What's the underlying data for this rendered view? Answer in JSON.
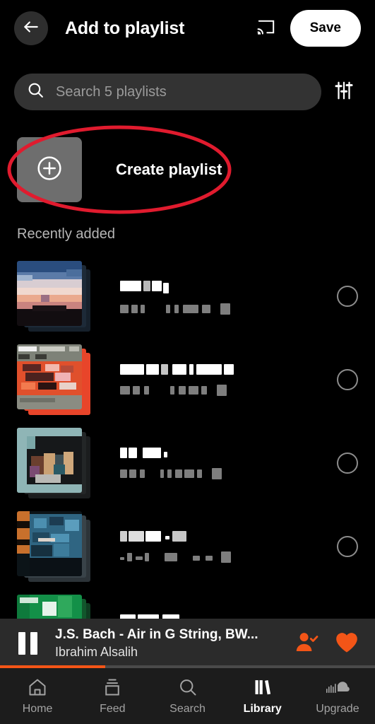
{
  "header": {
    "back_icon": "arrow-left-icon",
    "title": "Add to playlist",
    "cast_icon": "cast-icon",
    "save_label": "Save"
  },
  "search": {
    "icon": "search-icon",
    "value": "",
    "placeholder": "Search 5 playlists",
    "filter_icon": "sliders-filter-icon"
  },
  "create_playlist": {
    "icon": "plus-circle-icon",
    "label": "Create playlist",
    "tile_color": "#6e6e6e"
  },
  "annotation": {
    "shape": "ellipse",
    "color": "#e01b2e",
    "target": "create-playlist-row"
  },
  "section": {
    "recently_added_label": "Recently added"
  },
  "playlists": [
    {
      "title_redacted": true,
      "subtitle_redacted": true,
      "cover": "sunset-sky",
      "selected": false
    },
    {
      "title_redacted": true,
      "subtitle_redacted": true,
      "cover": "red-orange-art",
      "selected": false
    },
    {
      "title_redacted": true,
      "subtitle_redacted": true,
      "cover": "teal-group-photo",
      "selected": false
    },
    {
      "title_redacted": true,
      "subtitle_redacted": true,
      "cover": "blue-orange-scene",
      "selected": false
    },
    {
      "title_redacted": true,
      "subtitle_redacted": true,
      "cover": "green-cover",
      "selected": false
    }
  ],
  "player": {
    "pause_icon": "pause-icon",
    "track_title": "J.S. Bach  -  Air in G String, BW...",
    "artist": "Ibrahim Alsalih",
    "follow_icon": "user-check-icon",
    "like_icon": "heart-filled-icon",
    "accent_color": "#f35517",
    "progress_percent": 28
  },
  "bottom_nav": {
    "items": [
      {
        "label": "Home",
        "icon": "home-icon",
        "active": false
      },
      {
        "label": "Feed",
        "icon": "feed-icon",
        "active": false
      },
      {
        "label": "Search",
        "icon": "search-icon",
        "active": false
      },
      {
        "label": "Library",
        "icon": "library-icon",
        "active": true
      },
      {
        "label": "Upgrade",
        "icon": "soundcloud-cloud-icon",
        "active": false
      }
    ]
  }
}
